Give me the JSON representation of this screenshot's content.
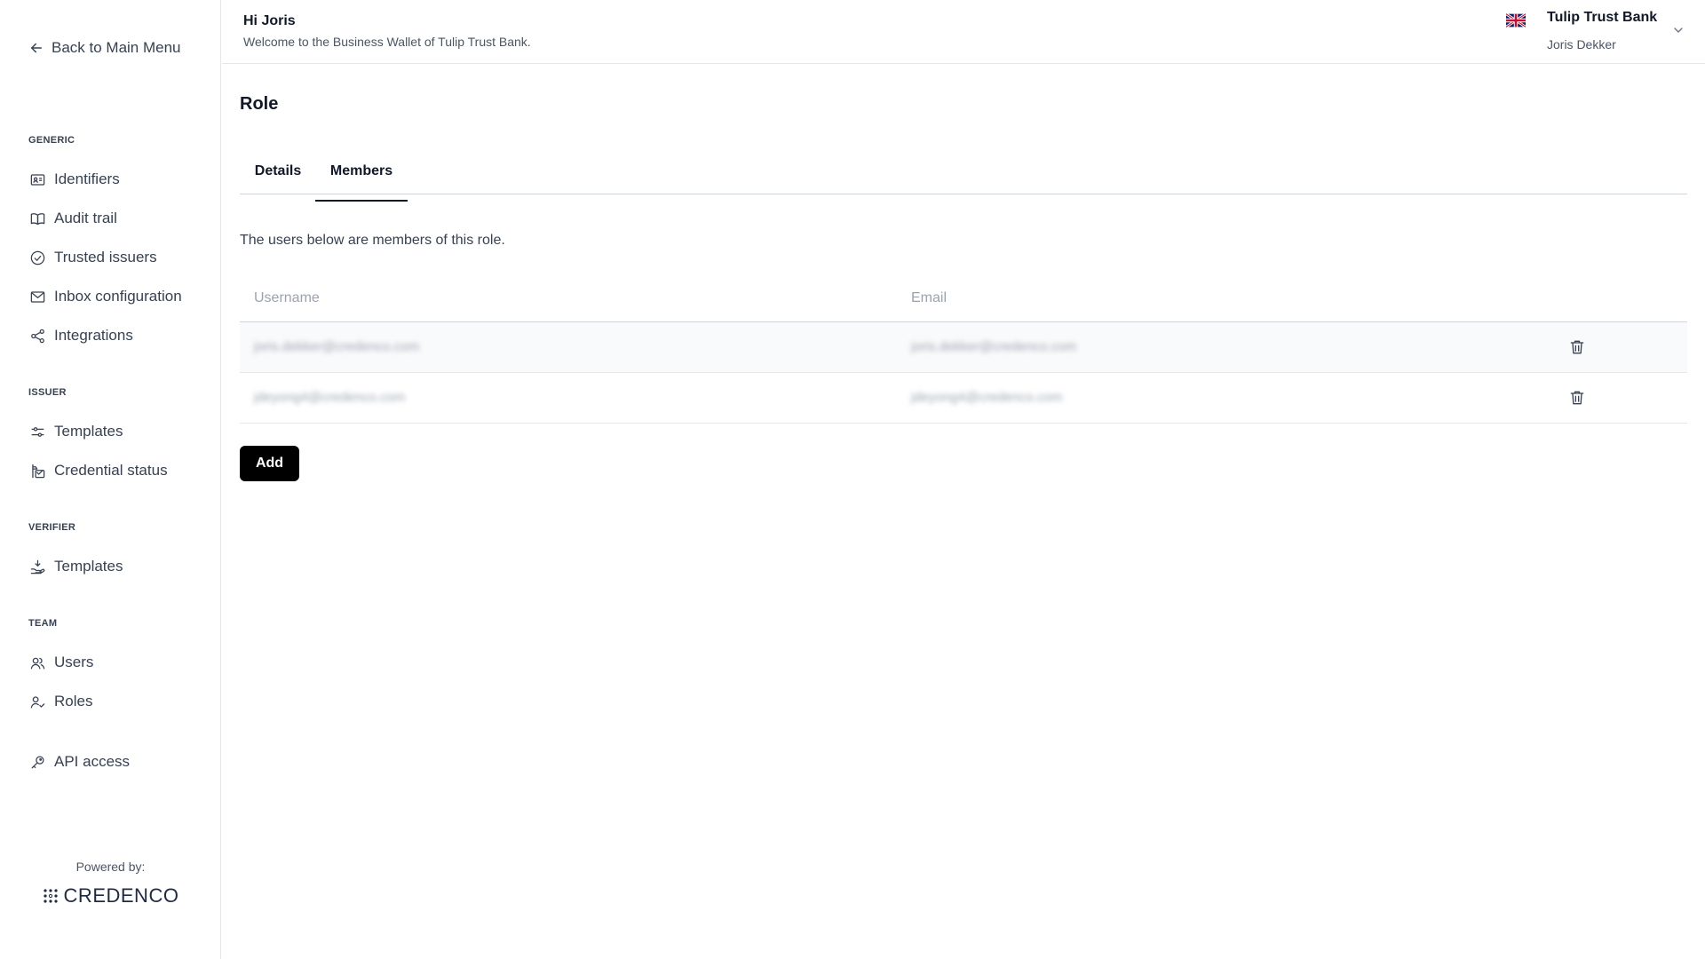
{
  "sidebar": {
    "back_label": "Back to Main Menu",
    "sections": {
      "generic": "GENERIC",
      "issuer": "ISSUER",
      "verifier": "VERIFIER",
      "team": "TEAM"
    },
    "items": {
      "identifiers": "Identifiers",
      "audit_trail": "Audit trail",
      "trusted_issuers": "Trusted issuers",
      "inbox_configuration": "Inbox configuration",
      "integrations": "Integrations",
      "issuer_templates": "Templates",
      "credential_status": "Credential status",
      "verifier_templates": "Templates",
      "users": "Users",
      "roles": "Roles",
      "api_access": "API access"
    },
    "powered_by": "Powered by:",
    "brand": "CREDENCO"
  },
  "header": {
    "greeting": "Hi Joris",
    "welcome": "Welcome to the Business Wallet of Tulip Trust Bank.",
    "bank_name": "Tulip Trust Bank",
    "user_name": "Joris Dekker"
  },
  "main": {
    "title": "Role",
    "tabs": {
      "details": "Details",
      "members": "Members"
    },
    "description": "The users below are members of this role.",
    "table": {
      "columns": {
        "username": "Username",
        "email": "Email"
      },
      "rows": [
        {
          "username": "joris.dekker@credenco.com",
          "email": "joris.dekker@credenco.com"
        },
        {
          "username": "jdeyong4@credenco.com",
          "email": "jdeyong4@credenco.com"
        }
      ]
    },
    "add_label": "Add"
  }
}
